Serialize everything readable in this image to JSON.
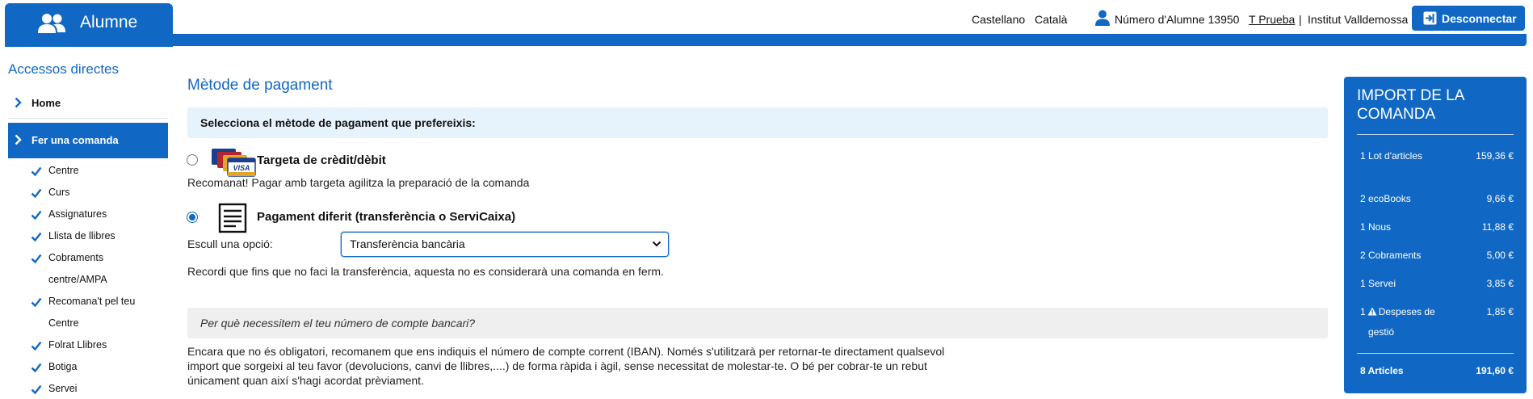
{
  "header": {
    "app_title": "Alumne",
    "lang_es": "Castellano",
    "lang_ca": "Català",
    "student_number": "Número d'Alumne 13950",
    "user_name": "T Prueba",
    "separator": "|",
    "school": "Institut Valldemossa",
    "logout": "Desconnectar"
  },
  "sidebar": {
    "title": "Accessos directes",
    "home": "Home",
    "active": "Fer una comanda",
    "items": [
      {
        "label": "Centre"
      },
      {
        "label": "Curs"
      },
      {
        "label": "Assignatures"
      },
      {
        "label": "Llista de llibres"
      },
      {
        "label": "Cobraments",
        "cont": "centre/AMPA"
      },
      {
        "label": "Recomana't pel teu",
        "cont": "Centre"
      },
      {
        "label": "Folrat Llibres"
      },
      {
        "label": "Botiga"
      },
      {
        "label": "Servei"
      }
    ]
  },
  "main": {
    "title": "Mètode de pagament",
    "select_prompt": "Selecciona el mètode de pagament que prefereixis:",
    "card_option": {
      "title": "Targeta de crèdit/dèbit",
      "note": "Recomanat! Pagar amb targeta agilitza la preparació de la comanda",
      "selected": false
    },
    "deferred_option": {
      "title": "Pagament diferit (transferència o ServiCaixa)",
      "selected": true,
      "choose_label": "Escull una opció:",
      "selected_value": "Transferència bancària",
      "reminder": "Recordi que fins que no faci la transferència, aquesta no es considerarà una comanda en ferm."
    },
    "why_heading": "Per què necessitem el teu número de compte bancari?",
    "why_text": "Encara que no és obligatori, recomanem que ens indiquis el número de compte corrent (IBAN). Només s'utilitzarà per retornar-te directament qualsevol import que sorgeixi al teu favor (devolucions, canvi de llibres,....) de forma ràpida i àgil, sense necessitat de molestar-te. O bé per cobrar-te un rebut únicament quan així s'hagi acordat prèviament."
  },
  "summary": {
    "heading": "IMPORT DE LA COMANDA",
    "rows": [
      {
        "name": "1 Lot d'articles",
        "price": "159,36 €"
      },
      {
        "name": "2 ecoBooks",
        "price": "9,66 €"
      },
      {
        "name": "1 Nous",
        "price": "11,88 €"
      },
      {
        "name": "2 Cobraments",
        "price": "5,00 €"
      },
      {
        "name": "1 Servei",
        "price": "3,85 €"
      }
    ],
    "fees": {
      "qty": "1",
      "name": "Despeses de",
      "name2": "gestió",
      "price": "1,85 €"
    },
    "total": {
      "name": "8 Articles",
      "price": "191,60 €"
    }
  },
  "colors": {
    "brand": "#1168c4",
    "banner": "#e6f3fc",
    "info": "#efefef"
  },
  "icons": [
    "users-icon",
    "user-icon",
    "exit-icon",
    "chevron-right-icon",
    "check-icon",
    "credit-cards-icon",
    "invoice-icon",
    "chevron-down-icon",
    "warning-icon"
  ]
}
